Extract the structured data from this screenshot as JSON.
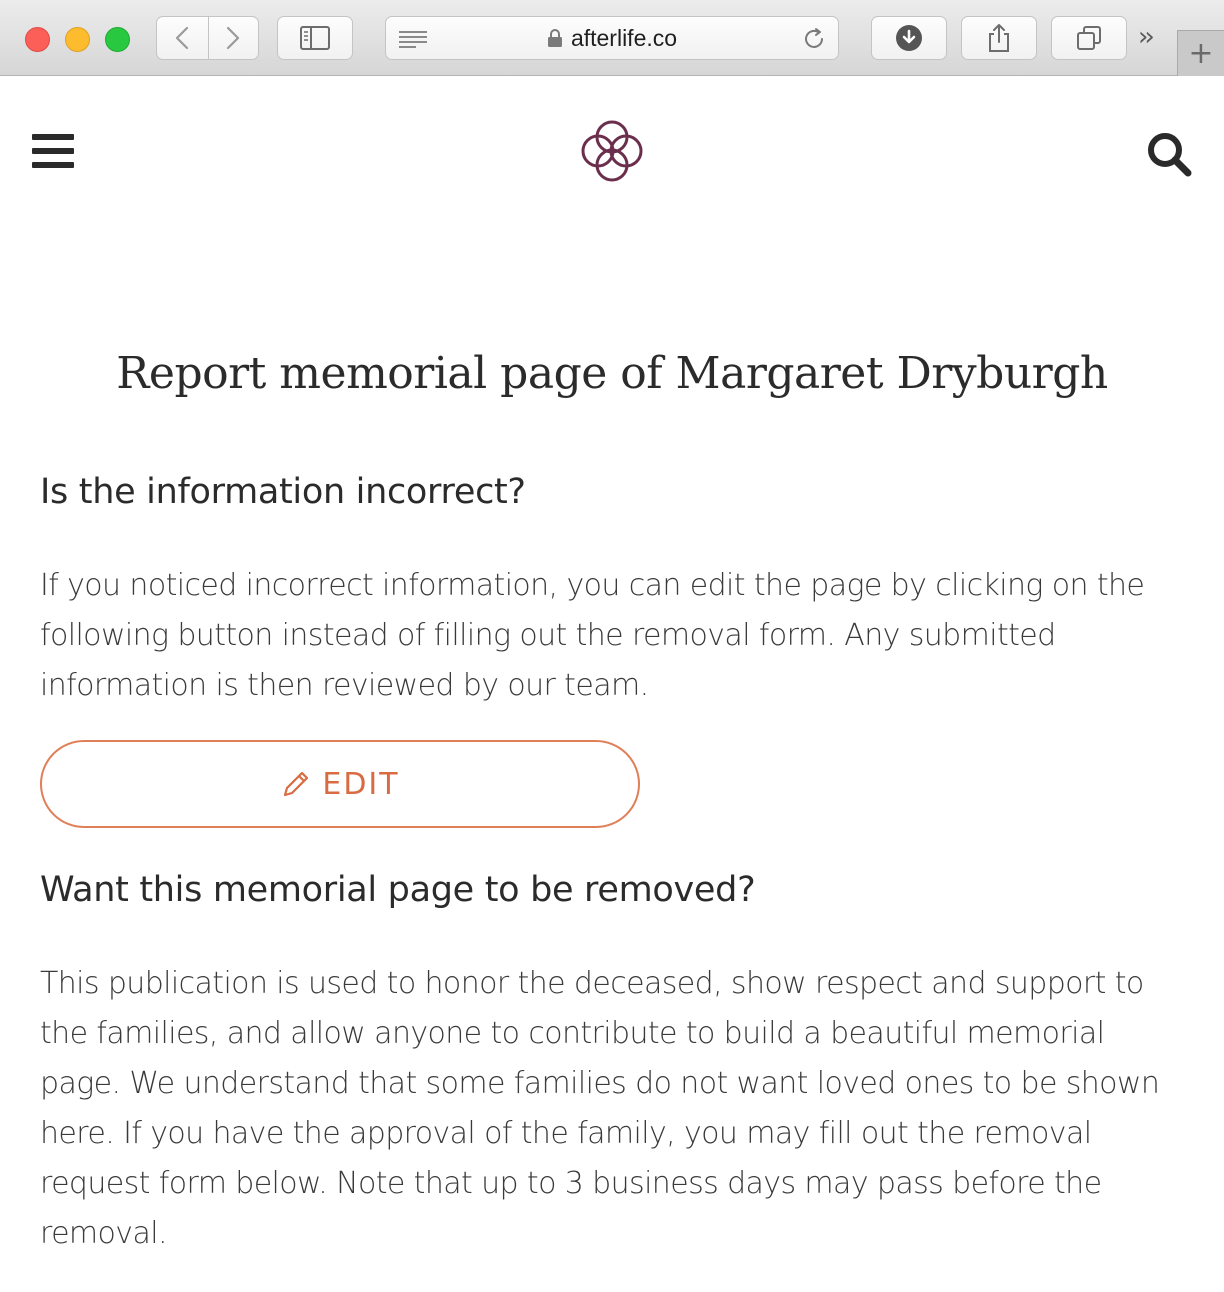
{
  "browser": {
    "url": "afterlife.co",
    "buttons": {
      "back": "back",
      "forward": "forward"
    },
    "icons": [
      "close-window",
      "minimize-window",
      "zoom-window",
      "chevron-left-icon",
      "chevron-right-icon",
      "sidebar-icon",
      "reader-icon",
      "lock-icon",
      "reload-icon",
      "download-icon",
      "share-icon",
      "tabs-icon",
      "more-icon",
      "plus-icon"
    ]
  },
  "header": {
    "icons": [
      "hamburger-menu-icon",
      "afterlife-logo",
      "search-icon"
    ],
    "logo_color": "#6b2e4d"
  },
  "main": {
    "title": "Report memorial page of Margaret Dryburgh",
    "incorrect": {
      "heading": "Is the information incorrect?",
      "body": "If you noticed incorrect information, you can edit the page by clicking on the following button instead of filling out the removal form. Any submitted information is then reviewed by our team.",
      "edit_label": "EDIT"
    },
    "removal": {
      "heading": "Want this memorial page to be removed?",
      "body": "This publication is used to honor the deceased, show respect and support to the families, and allow anyone to contribute to build a beautiful memorial page. We understand that some families do not want loved ones to be shown here. If you have the approval of the family, you may fill out the removal request form below. Note that up to 3 business days may pass before the removal."
    }
  },
  "colors": {
    "accent": "#df7f58",
    "text": "#2b2b2b"
  }
}
